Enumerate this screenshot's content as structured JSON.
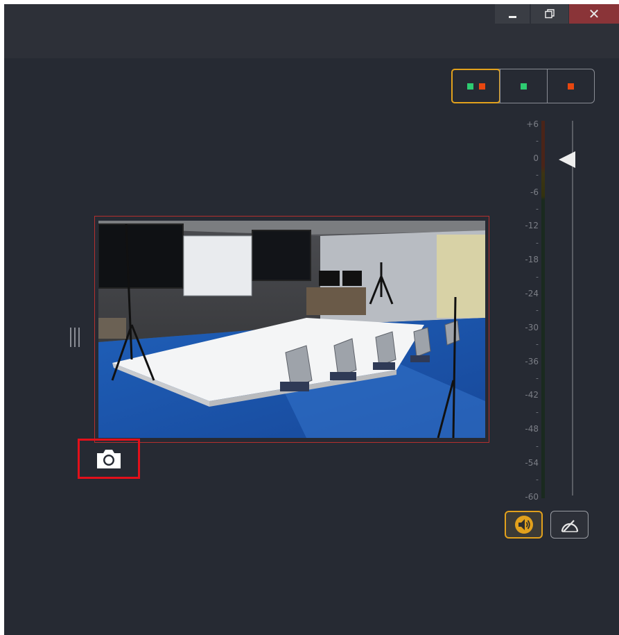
{
  "window": {
    "controls": {
      "minimize_icon": "minimize-icon",
      "maximize_icon": "restore-icon",
      "close_label": "✕"
    }
  },
  "display_mode": {
    "selected": "both",
    "options": [
      {
        "id": "both",
        "icon": "green-red-squares-icon",
        "colors": [
          "#2ecc71",
          "#e8470f"
        ]
      },
      {
        "id": "green",
        "icon": "green-square-icon",
        "colors": [
          "#2ecc71"
        ]
      },
      {
        "id": "red",
        "icon": "red-square-icon",
        "colors": [
          "#e8470f"
        ]
      }
    ]
  },
  "meter": {
    "ticks": [
      "+6",
      "0",
      "-6",
      "-12",
      "-18",
      "-24",
      "-30",
      "-36",
      "-42",
      "-48",
      "-54",
      "-60"
    ],
    "level_db": 0
  },
  "video": {
    "description": "conference room camera preview"
  },
  "buttons": {
    "snapshot_icon": "camera-icon",
    "audio_icon": "speaker-icon",
    "agc_icon": "gauge-icon"
  },
  "colors": {
    "accent": "#e2a11c",
    "background": "#262a33",
    "title_bar": "#2d3038",
    "frame_border": "#b5302e",
    "highlight": "#e3101a"
  }
}
